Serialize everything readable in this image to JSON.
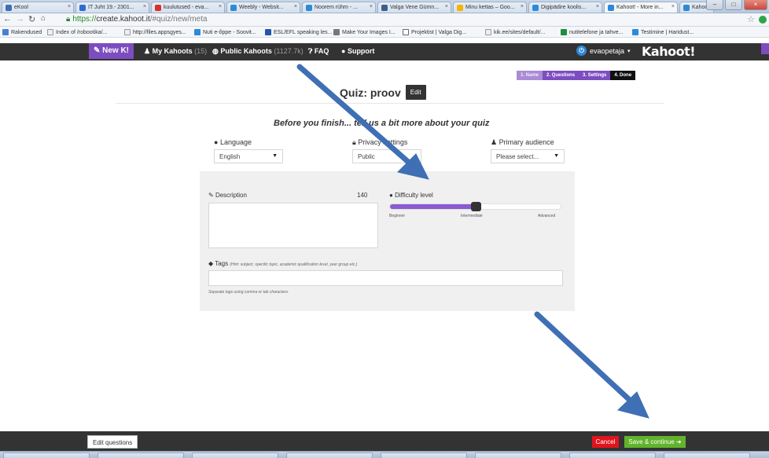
{
  "browser": {
    "tabs": [
      {
        "label": "eKool",
        "color": "#3b6fb5"
      },
      {
        "label": "IT Juht 19.- 2301...",
        "color": "#2d6bd1"
      },
      {
        "label": "kuulutused - eva...",
        "color": "#d93025"
      },
      {
        "label": "Weebly - Websit...",
        "color": "#2b8bd8"
      },
      {
        "label": "Noorem rühm - ...",
        "color": "#2b8bd8"
      },
      {
        "label": "Valga Vene Gümn...",
        "color": "#3a5f8a"
      },
      {
        "label": "Minu kettas – Goo...",
        "color": "#f4b400"
      },
      {
        "label": "Digipädire koolis...",
        "color": "#2b8bd8"
      },
      {
        "label": "Kahoot! - More in...",
        "color": "#2d89d8"
      },
      {
        "label": "Kahoot!",
        "color": "#2d89d8"
      }
    ],
    "url_scheme": "https://",
    "url_host": "create.kahoot.it",
    "url_path": "/#quiz/new/meta",
    "bookmarks": [
      "Rakendused",
      "Index of /robootika/...",
      "http://files.appsgyes...",
      "Nuti e-õppe - Soovit...",
      "ESL/EFL speaking les...",
      "Make Your Images I...",
      "Projektist | Valga Dig...",
      "kik.ee/sites/default/...",
      "nutitelefone ja tahve...",
      "Testimine | Haridust..."
    ]
  },
  "nav": {
    "new_label": "New K!",
    "my_kahoots_label": "My Kahoots",
    "my_kahoots_count": "(15)",
    "public_label": "Public Kahoots",
    "public_count": "(1127.7k)",
    "faq_label": "FAQ",
    "support_label": "Support",
    "user_name": "evaopetaja",
    "logo": "Kahoot!"
  },
  "steps": [
    {
      "label": "1. Name"
    },
    {
      "label": "2. Questions"
    },
    {
      "label": "3. Settings"
    },
    {
      "label": "4. Done"
    }
  ],
  "quiz": {
    "title": "Quiz: proov",
    "edit_label": "Edit",
    "subtitle": "Before you finish... tell us a bit more about your quiz"
  },
  "fields": {
    "language_label": "Language",
    "language_value": "English",
    "privacy_label": "Privacy settings",
    "privacy_value": "Public",
    "audience_label": "Primary audience",
    "audience_value": "Please select...",
    "description_label": "Description",
    "description_counter": "140",
    "difficulty_label": "Difficulty level",
    "difficulty_value": 0.5,
    "levels": [
      "Beginner",
      "Intermediate",
      "Advanced"
    ],
    "tags_label": "Tags",
    "tags_hint": "(Hint: subject, specific topic, academic qualification level, year group etc.)",
    "tags_note": "Separate tags using comma or tab characters."
  },
  "footer": {
    "edit_questions_label": "Edit questions",
    "cancel_label": "Cancel",
    "save_label": "Save & continue"
  },
  "colors": {
    "purple": "#7d4dc0",
    "arrow": "#3f6fb5",
    "save": "#62b32c",
    "cancel": "#e1141e"
  }
}
